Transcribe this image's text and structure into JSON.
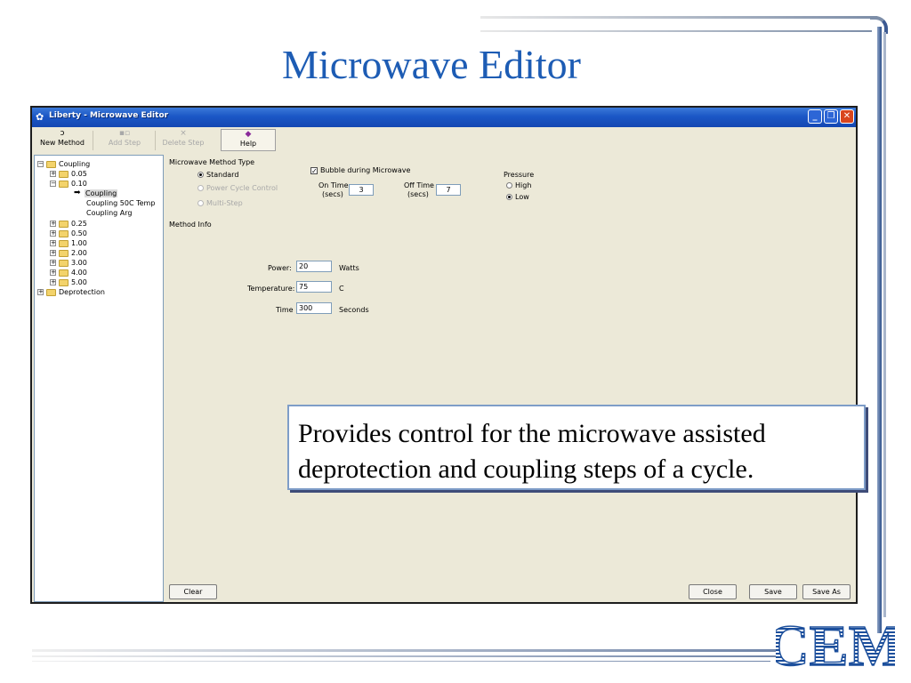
{
  "slide": {
    "title": "Microwave Editor",
    "callout": "Provides control for the microwave assisted deprotection and coupling steps of a cycle.",
    "logo_text": "CEM",
    "accent_color": "#1d5cb4"
  },
  "window": {
    "title": "Liberty - Microwave Editor",
    "controls": {
      "minimize": "_",
      "maximize": "❐",
      "close": "✕"
    }
  },
  "toolbar": {
    "new_method": "New Method",
    "add_step": "Add Step",
    "delete_step": "Delete Step",
    "help": "Help"
  },
  "tree": {
    "coupling": "Coupling",
    "v005": "0.05",
    "v010": "0.10",
    "coupling_child": "Coupling",
    "coupling_50c": "Coupling 50C Temp",
    "coupling_arg": "Coupling Arg",
    "v025": "0.25",
    "v050": "0.50",
    "v100": "1.00",
    "v200": "2.00",
    "v300": "3.00",
    "v400": "4.00",
    "v500": "5.00",
    "deprotection": "Deprotection",
    "plus": "+",
    "minus": "−"
  },
  "method": {
    "type_label": "Microwave Method Type",
    "standard": "Standard",
    "power_cycle": "Power Cycle Control",
    "multi_step": "Multi-Step",
    "bubble": "Bubble during Microwave",
    "on_time_label": "On Time",
    "on_time_unit": "(secs)",
    "on_time_value": "3",
    "off_time_label": "Off Time",
    "off_time_unit": "(secs)",
    "off_time_value": "7",
    "pressure_label": "Pressure",
    "high": "High",
    "low": "Low",
    "info_label": "Method Info",
    "power_label": "Power:",
    "power_value": "20",
    "power_unit": "Watts",
    "temp_label": "Temperature:",
    "temp_value": "75",
    "temp_unit": "C",
    "time_label": "Time",
    "time_value": "300",
    "time_unit": "Seconds"
  },
  "buttons": {
    "clear": "Clear",
    "close": "Close",
    "save": "Save",
    "save_as": "Save As"
  }
}
